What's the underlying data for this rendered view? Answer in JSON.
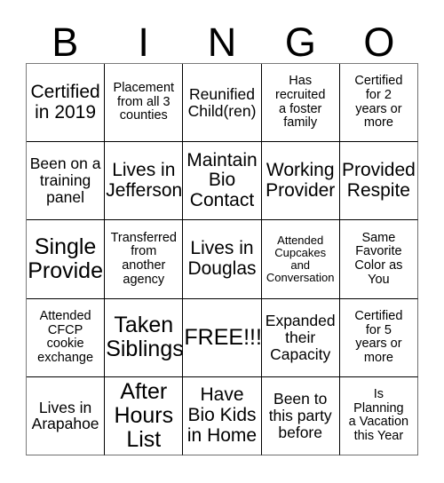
{
  "card": {
    "header_letters": [
      "B",
      "I",
      "N",
      "G",
      "O"
    ],
    "columns": 5,
    "rows": 5,
    "colors": {
      "background": "#ffffff",
      "text": "#000000",
      "grid_line": "#000000",
      "outer_line": "#7a7a7a"
    },
    "cells": [
      {
        "text": "Certified\nin 2019",
        "size": "lg"
      },
      {
        "text": "Placement\nfrom all 3\ncounties",
        "size": "sm"
      },
      {
        "text": "Reunified\nChild(ren)",
        "size": "md"
      },
      {
        "text": "Has\nrecruited\na foster\nfamily",
        "size": "sm"
      },
      {
        "text": "Certified\nfor 2\nyears or\nmore",
        "size": "sm"
      },
      {
        "text": "Been on a\ntraining\npanel",
        "size": "md"
      },
      {
        "text": "Lives in\nJefferson",
        "size": "lg"
      },
      {
        "text": "Maintain\nBio\nContact",
        "size": "lg"
      },
      {
        "text": "Working\nProvider",
        "size": "lg"
      },
      {
        "text": "Provided\nRespite",
        "size": "lg"
      },
      {
        "text": "Single\nProvide",
        "size": "xl"
      },
      {
        "text": "Transferred\nfrom\nanother\nagency",
        "size": "sm"
      },
      {
        "text": "Lives in\nDouglas",
        "size": "lg"
      },
      {
        "text": "Attended\nCupcakes\nand\nConversation",
        "size": "xs"
      },
      {
        "text": "Same\nFavorite\nColor as\nYou",
        "size": "sm"
      },
      {
        "text": "Attended\nCFCP\ncookie\nexchange",
        "size": "sm"
      },
      {
        "text": "Taken\nSiblings",
        "size": "xl"
      },
      {
        "text": "FREE!!!",
        "size": "xl"
      },
      {
        "text": "Expanded\ntheir\nCapacity",
        "size": "md"
      },
      {
        "text": "Certified\nfor 5\nyears or\nmore",
        "size": "sm"
      },
      {
        "text": "Lives in\nArapahoe",
        "size": "md"
      },
      {
        "text": "After\nHours\nList",
        "size": "xl"
      },
      {
        "text": "Have\nBio Kids\nin Home",
        "size": "lg"
      },
      {
        "text": "Been to\nthis party\nbefore",
        "size": "md"
      },
      {
        "text": "Is\nPlanning\na Vacation\nthis Year",
        "size": "sm"
      }
    ]
  }
}
